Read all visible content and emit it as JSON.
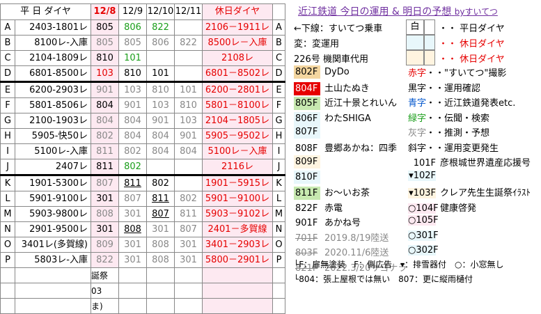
{
  "header": {
    "weekday": "平 日 ダイヤ",
    "d1": "12/8",
    "d2": "12/9",
    "d3": "12/10",
    "d4": "12/11",
    "holiday": "休日ダイヤ"
  },
  "rows": [
    {
      "k": "A",
      "dia": "2403-1801レ",
      "v": [
        "805",
        "806",
        "822",
        ""
      ],
      "hol": "2106－1911レ"
    },
    {
      "k": "B",
      "dia": "8100レ-入庫",
      "v": [
        "805",
        "805",
        "806",
        "822"
      ],
      "hol": "8500レ－入庫"
    },
    {
      "k": "C",
      "dia": "2104-1809レ",
      "v": [
        "810",
        "101",
        "",
        ""
      ],
      "hol": "2108レ"
    },
    {
      "k": "D",
      "dia": "6801-8500レ",
      "v": [
        "103",
        "810",
        "101",
        ""
      ],
      "hol": "6801－8502レ"
    },
    {
      "k": "E",
      "dia": "6200-2903レ",
      "v": [
        "901",
        "103",
        "810",
        "101"
      ],
      "hol": "6200－2801レ"
    },
    {
      "k": "F",
      "dia": "5801-8506レ",
      "v": [
        "804",
        "901",
        "103",
        "810"
      ],
      "hol": "5801－8100レ"
    },
    {
      "k": "G",
      "dia": "2100-1903レ",
      "v": [
        "804",
        "804",
        "901",
        "103"
      ],
      "hol": "2104－1805レ"
    },
    {
      "k": "H",
      "dia": "5905-快50レ",
      "v": [
        "802",
        "804",
        "804",
        "901"
      ],
      "hol": "5905－9502レ"
    },
    {
      "k": "I",
      "dia": "5100レ-入庫",
      "v": [
        "811",
        "802",
        "804",
        "804"
      ],
      "hol": "5100レ－入庫"
    },
    {
      "k": "J",
      "dia": "2407レ",
      "v": [
        "811",
        "802",
        "",
        ""
      ],
      "hol": "2116レ"
    },
    {
      "k": "K",
      "dia": "1901-5300レ",
      "v": [
        "807",
        "811",
        "802",
        ""
      ],
      "hol": "1901－5915レ"
    },
    {
      "k": "L",
      "dia": "5901-9100レ",
      "v": [
        "301",
        "807",
        "811",
        "802"
      ],
      "hol": "5901－9100レ"
    },
    {
      "k": "M",
      "dia": "5903-9800レ",
      "v": [
        "808",
        "301",
        "807",
        "811"
      ],
      "hol": "5903－9102レ"
    },
    {
      "k": "N",
      "dia": "2901-9500レ",
      "v": [
        "301",
        "808",
        "301",
        "807"
      ],
      "hol": "2401－多賀線"
    },
    {
      "k": "O",
      "dia": "3401レ(多賀線)",
      "v": [
        "809",
        "301",
        "808",
        "301"
      ],
      "hol": "3401－2903レ"
    },
    {
      "k": "P",
      "dia": "5803レ-入庫",
      "v": [
        "822",
        "301",
        "808",
        "301"
      ],
      "hol": "5800－2901レ"
    }
  ],
  "extra": [
    "誕祭",
    "03",
    "ま)"
  ],
  "panel": {
    "title": "近江鉄道 今日の運用 & 明日の予想",
    "by": "byすいてつ",
    "legend1": "←下線：すいてつ乗車",
    "legend2": "変：変運用",
    "legend3": "226号 機関車代用",
    "tag_white": "白",
    "weekday_label": "・・ 平日ダイヤ",
    "holiday_label1": "・・ 休日ダイヤ",
    "holiday_label2": "・・ 休日ダイヤ",
    "cars": [
      {
        "code": "802F",
        "name": "DyDo"
      },
      {
        "code": "804F",
        "name": "土山たぬき"
      },
      {
        "code": "805F",
        "name": "近江十景とれいん"
      },
      {
        "code": "806F",
        "name": "わたSHIGA"
      },
      {
        "code": "807F",
        "name": ""
      },
      {
        "code": "808F",
        "name": "豊郷あかね：四季"
      },
      {
        "code": "809F",
        "name": ""
      },
      {
        "code": "810F",
        "name": ""
      },
      {
        "code": "811F",
        "name": "お〜いお茶"
      },
      {
        "code": "822F",
        "name": "赤電"
      },
      {
        "code": "901F",
        "name": "あかね号"
      },
      {
        "code": "701F",
        "name": "2019.8/19陸送"
      },
      {
        "code": "803F",
        "name": "2020.11/6陸送"
      },
      {
        "code": "821F",
        "name": "2022.3/20サヨナラ"
      }
    ],
    "keys": [
      {
        "k": "赤字",
        "v": "・・\"すいてつ\"撮影"
      },
      {
        "k": "黒字",
        "v": "・・運用確認"
      },
      {
        "k": "青字",
        "v": "・・近江鉄道発表etc."
      },
      {
        "k": "緑字",
        "v": "・・伝聞・検索"
      },
      {
        "k": "灰字",
        "v": "・・推測・予想"
      },
      {
        "k": "斜字",
        "v": "・・運用変更発生"
      }
    ],
    "small": [
      {
        "code": "101F",
        "name": "彦根城世界遺産応援号"
      },
      {
        "code": "▾102F",
        "name": ""
      },
      {
        "code": "▾103F",
        "name": "クレア先生生誕祭ｲﾗｽﾄ"
      },
      {
        "code": "○104F",
        "name": "健康啓発"
      },
      {
        "code": "○105F",
        "name": ""
      },
      {
        "code": "○301F",
        "name": ""
      },
      {
        "code": "○302F",
        "name": ""
      }
    ],
    "foot1": "└F：扉無塗装　F：側広告　▾：排雪器付　○：小窓無し",
    "foot2": "└804：張上屋根では無い　807：更に縦雨樋付"
  }
}
